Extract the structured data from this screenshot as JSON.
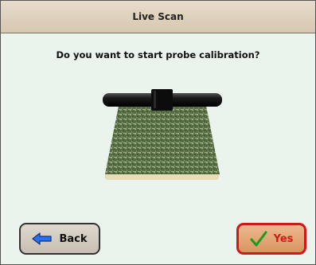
{
  "window": {
    "title": "Live Scan"
  },
  "dialog": {
    "question": "Do you want to start probe calibration?"
  },
  "buttons": {
    "back_label": "Back",
    "yes_label": "Yes"
  },
  "icons": {
    "back": "arrow-left-icon",
    "yes": "checkmark-icon"
  },
  "colors": {
    "title_bar": "#d6c7b0",
    "background": "#eaf3ec",
    "yes_border": "#cc1a1a",
    "yes_text": "#d71818",
    "check_green": "#1a9b1a",
    "arrow_blue": "#2a6ff0"
  }
}
